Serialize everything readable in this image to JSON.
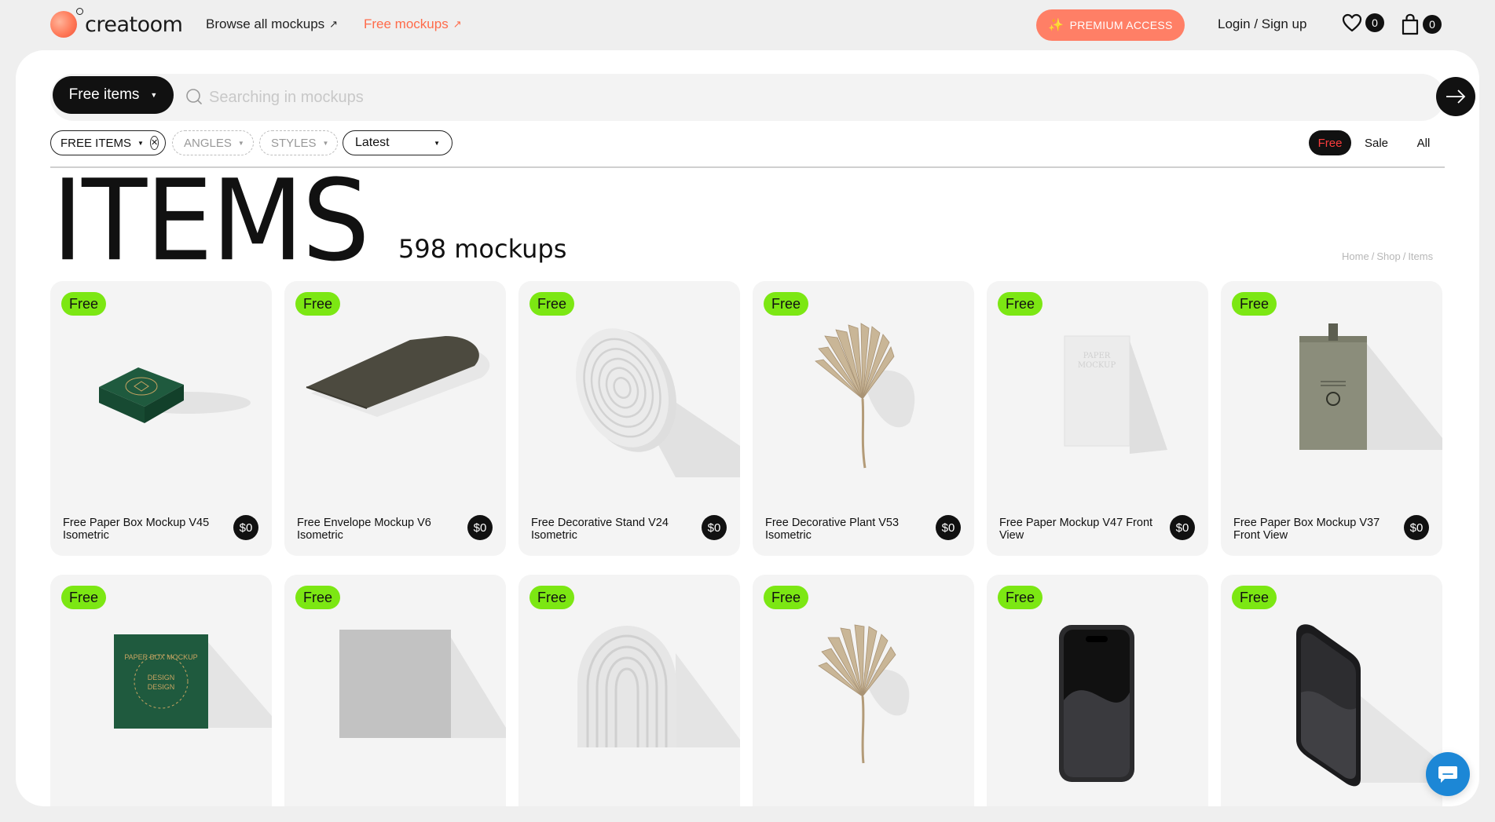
{
  "brand": {
    "name": "creatoom"
  },
  "nav": {
    "browse_label": "Browse all mockups",
    "free_label": "Free mockups",
    "premium_label": "PREMIUM ACCESS",
    "login_label": "Login / Sign up",
    "wishlist_count": "0",
    "cart_count": "0"
  },
  "search": {
    "scope_label": "Free items",
    "placeholder": "Searching in mockups"
  },
  "filters": {
    "free_items": "FREE ITEMS",
    "angles": "ANGLES",
    "styles": "STYLES",
    "sort": "Latest"
  },
  "price_tabs": {
    "free": "Free",
    "sale": "Sale",
    "all": "All",
    "active": "Free"
  },
  "heading": {
    "title": "ITEMS",
    "count": "598 mockups"
  },
  "breadcrumb": {
    "home": "Home",
    "sep": "/",
    "shop": "Shop",
    "current": "Items"
  },
  "colors": {
    "accent_orange": "#ff7f66",
    "free_badge": "#7ce713",
    "free_tab_text": "#ff3d3d",
    "chat": "#1c87d6"
  },
  "products": [
    {
      "badge": "Free",
      "title": "Free Paper Box Mockup V45 Isometric",
      "price": "$0",
      "art": "green-box"
    },
    {
      "badge": "Free",
      "title": "Free Envelope Mockup V6 Isometric",
      "price": "$0",
      "art": "envelope"
    },
    {
      "badge": "Free",
      "title": "Free Decorative Stand V24 Isometric",
      "price": "$0",
      "art": "round-stand"
    },
    {
      "badge": "Free",
      "title": "Free Decorative Plant V53 Isometric",
      "price": "$0",
      "art": "plant"
    },
    {
      "badge": "Free",
      "title": "Free Paper Mockup V47 Front View",
      "price": "$0",
      "art": "paper"
    },
    {
      "badge": "Free",
      "title": "Free Paper Box Mockup V37 Front View",
      "price": "$0",
      "art": "tall-box"
    },
    {
      "badge": "Free",
      "title": "",
      "price": "",
      "art": "green-square"
    },
    {
      "badge": "Free",
      "title": "",
      "price": "",
      "art": "gray-square"
    },
    {
      "badge": "Free",
      "title": "",
      "price": "",
      "art": "arch-stand"
    },
    {
      "badge": "Free",
      "title": "",
      "price": "",
      "art": "plant-2"
    },
    {
      "badge": "Free",
      "title": "",
      "price": "",
      "art": "phone-front"
    },
    {
      "badge": "Free",
      "title": "",
      "price": "",
      "art": "phone-angle"
    }
  ],
  "box_print": {
    "green_square": [
      "PAPER BOX MOCKUP",
      "DESIGN",
      "DESIGN"
    ],
    "paper_sheet": [
      "PAPER",
      "MOCKUP"
    ]
  }
}
